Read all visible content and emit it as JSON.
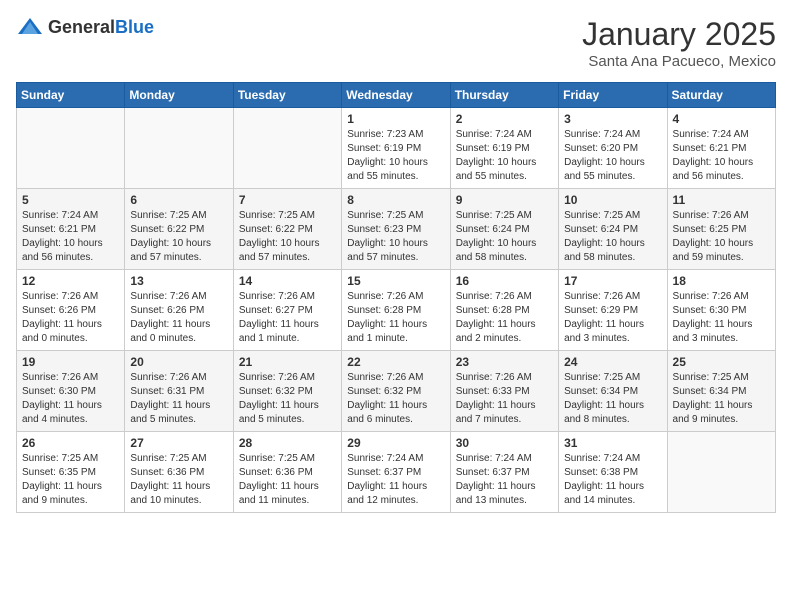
{
  "header": {
    "logo_general": "General",
    "logo_blue": "Blue",
    "month": "January 2025",
    "location": "Santa Ana Pacueco, Mexico"
  },
  "weekdays": [
    "Sunday",
    "Monday",
    "Tuesday",
    "Wednesday",
    "Thursday",
    "Friday",
    "Saturday"
  ],
  "weeks": [
    [
      {
        "day": "",
        "info": ""
      },
      {
        "day": "",
        "info": ""
      },
      {
        "day": "",
        "info": ""
      },
      {
        "day": "1",
        "info": "Sunrise: 7:23 AM\nSunset: 6:19 PM\nDaylight: 10 hours and 55 minutes."
      },
      {
        "day": "2",
        "info": "Sunrise: 7:24 AM\nSunset: 6:19 PM\nDaylight: 10 hours and 55 minutes."
      },
      {
        "day": "3",
        "info": "Sunrise: 7:24 AM\nSunset: 6:20 PM\nDaylight: 10 hours and 55 minutes."
      },
      {
        "day": "4",
        "info": "Sunrise: 7:24 AM\nSunset: 6:21 PM\nDaylight: 10 hours and 56 minutes."
      }
    ],
    [
      {
        "day": "5",
        "info": "Sunrise: 7:24 AM\nSunset: 6:21 PM\nDaylight: 10 hours and 56 minutes."
      },
      {
        "day": "6",
        "info": "Sunrise: 7:25 AM\nSunset: 6:22 PM\nDaylight: 10 hours and 57 minutes."
      },
      {
        "day": "7",
        "info": "Sunrise: 7:25 AM\nSunset: 6:22 PM\nDaylight: 10 hours and 57 minutes."
      },
      {
        "day": "8",
        "info": "Sunrise: 7:25 AM\nSunset: 6:23 PM\nDaylight: 10 hours and 57 minutes."
      },
      {
        "day": "9",
        "info": "Sunrise: 7:25 AM\nSunset: 6:24 PM\nDaylight: 10 hours and 58 minutes."
      },
      {
        "day": "10",
        "info": "Sunrise: 7:25 AM\nSunset: 6:24 PM\nDaylight: 10 hours and 58 minutes."
      },
      {
        "day": "11",
        "info": "Sunrise: 7:26 AM\nSunset: 6:25 PM\nDaylight: 10 hours and 59 minutes."
      }
    ],
    [
      {
        "day": "12",
        "info": "Sunrise: 7:26 AM\nSunset: 6:26 PM\nDaylight: 11 hours and 0 minutes."
      },
      {
        "day": "13",
        "info": "Sunrise: 7:26 AM\nSunset: 6:26 PM\nDaylight: 11 hours and 0 minutes."
      },
      {
        "day": "14",
        "info": "Sunrise: 7:26 AM\nSunset: 6:27 PM\nDaylight: 11 hours and 1 minute."
      },
      {
        "day": "15",
        "info": "Sunrise: 7:26 AM\nSunset: 6:28 PM\nDaylight: 11 hours and 1 minute."
      },
      {
        "day": "16",
        "info": "Sunrise: 7:26 AM\nSunset: 6:28 PM\nDaylight: 11 hours and 2 minutes."
      },
      {
        "day": "17",
        "info": "Sunrise: 7:26 AM\nSunset: 6:29 PM\nDaylight: 11 hours and 3 minutes."
      },
      {
        "day": "18",
        "info": "Sunrise: 7:26 AM\nSunset: 6:30 PM\nDaylight: 11 hours and 3 minutes."
      }
    ],
    [
      {
        "day": "19",
        "info": "Sunrise: 7:26 AM\nSunset: 6:30 PM\nDaylight: 11 hours and 4 minutes."
      },
      {
        "day": "20",
        "info": "Sunrise: 7:26 AM\nSunset: 6:31 PM\nDaylight: 11 hours and 5 minutes."
      },
      {
        "day": "21",
        "info": "Sunrise: 7:26 AM\nSunset: 6:32 PM\nDaylight: 11 hours and 5 minutes."
      },
      {
        "day": "22",
        "info": "Sunrise: 7:26 AM\nSunset: 6:32 PM\nDaylight: 11 hours and 6 minutes."
      },
      {
        "day": "23",
        "info": "Sunrise: 7:26 AM\nSunset: 6:33 PM\nDaylight: 11 hours and 7 minutes."
      },
      {
        "day": "24",
        "info": "Sunrise: 7:25 AM\nSunset: 6:34 PM\nDaylight: 11 hours and 8 minutes."
      },
      {
        "day": "25",
        "info": "Sunrise: 7:25 AM\nSunset: 6:34 PM\nDaylight: 11 hours and 9 minutes."
      }
    ],
    [
      {
        "day": "26",
        "info": "Sunrise: 7:25 AM\nSunset: 6:35 PM\nDaylight: 11 hours and 9 minutes."
      },
      {
        "day": "27",
        "info": "Sunrise: 7:25 AM\nSunset: 6:36 PM\nDaylight: 11 hours and 10 minutes."
      },
      {
        "day": "28",
        "info": "Sunrise: 7:25 AM\nSunset: 6:36 PM\nDaylight: 11 hours and 11 minutes."
      },
      {
        "day": "29",
        "info": "Sunrise: 7:24 AM\nSunset: 6:37 PM\nDaylight: 11 hours and 12 minutes."
      },
      {
        "day": "30",
        "info": "Sunrise: 7:24 AM\nSunset: 6:37 PM\nDaylight: 11 hours and 13 minutes."
      },
      {
        "day": "31",
        "info": "Sunrise: 7:24 AM\nSunset: 6:38 PM\nDaylight: 11 hours and 14 minutes."
      },
      {
        "day": "",
        "info": ""
      }
    ]
  ]
}
